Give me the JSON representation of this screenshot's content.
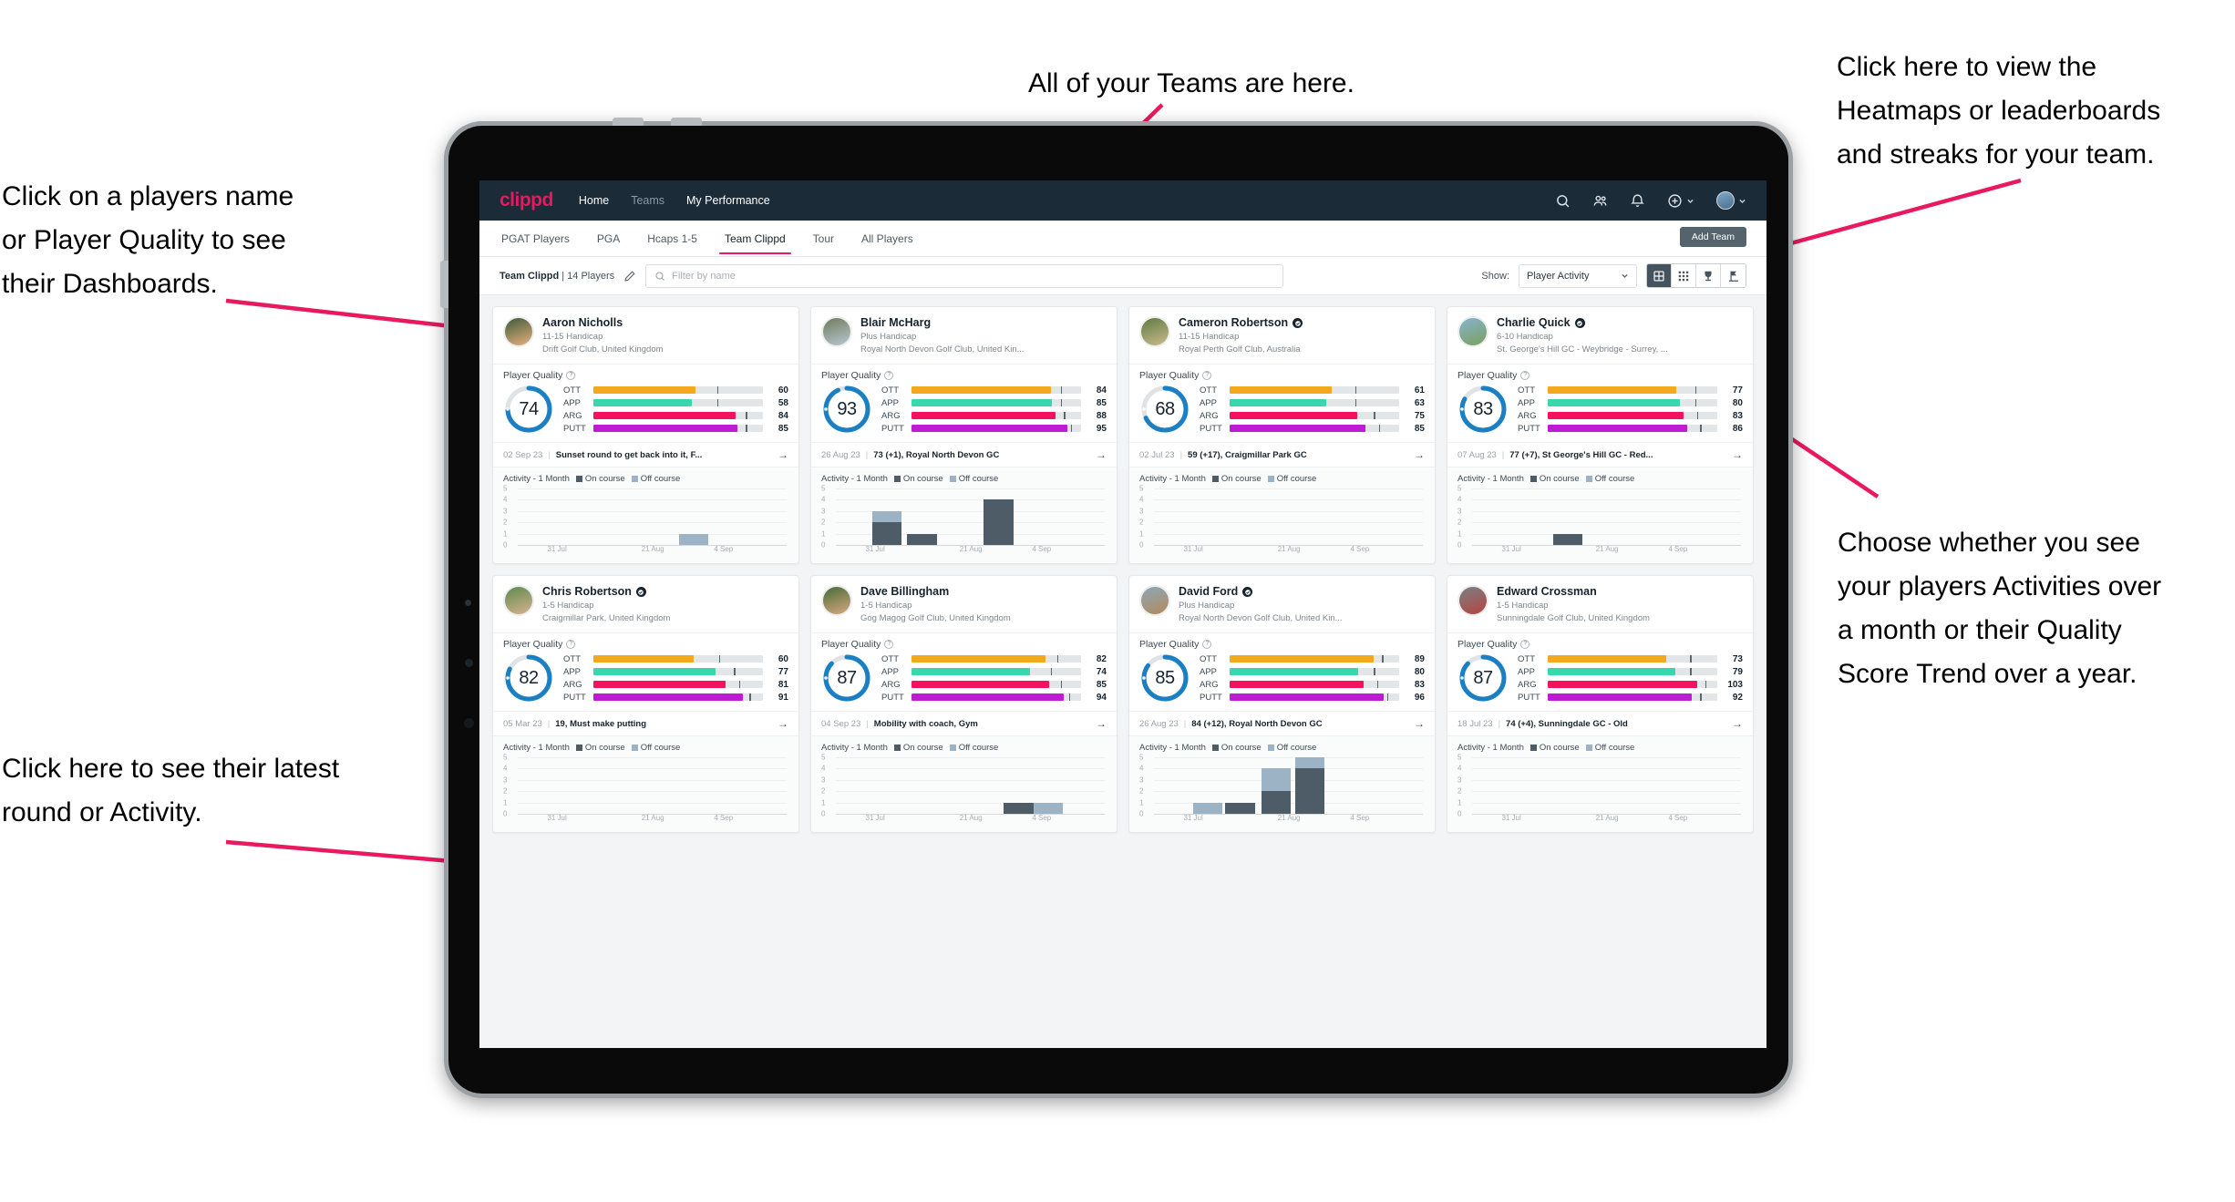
{
  "annotations": [
    {
      "id": "teams",
      "text": "All of your Teams are here."
    },
    {
      "id": "heatmaps",
      "text": "Click here to view the\nHeatmaps or leaderboards\nand streaks for your team."
    },
    {
      "id": "players-name",
      "text": "Click on a players name\nor Player Quality to see\ntheir Dashboards."
    },
    {
      "id": "activity-choice",
      "text": "Choose whether you see\nyour players Activities over\na month or their Quality\nScore Trend over a year."
    },
    {
      "id": "latest-round",
      "text": "Click here to see their latest\nround or Activity."
    }
  ],
  "topnav": {
    "brand": "clippd",
    "links": [
      {
        "label": "Home",
        "state": "active"
      },
      {
        "label": "Teams",
        "state": "dim"
      },
      {
        "label": "My Performance",
        "state": "active"
      }
    ],
    "icons": [
      "search-icon",
      "team-icon",
      "bell-icon",
      "plus-circle-icon",
      "avatar"
    ]
  },
  "subnav": {
    "tabs": [
      {
        "label": "PGAT Players",
        "active": false
      },
      {
        "label": "PGA",
        "active": false
      },
      {
        "label": "Hcaps 1-5",
        "active": false
      },
      {
        "label": "Team Clippd",
        "active": true
      },
      {
        "label": "Tour",
        "active": false
      },
      {
        "label": "All Players",
        "active": false
      }
    ],
    "add_team_label": "Add Team"
  },
  "filterbar": {
    "team_name": "Team Clippd",
    "team_count": "| 14 Players",
    "edit_icon": "pencil-icon",
    "search_placeholder": "Filter by name",
    "show_label": "Show:",
    "show_value": "Player Activity",
    "view_buttons": [
      "grid-view-icon",
      "dense-grid-icon",
      "trophy-icon",
      "leaderboard-icon"
    ],
    "active_view": 0
  },
  "labels": {
    "player_quality": "Player Quality",
    "activity": "Activity - 1 Month",
    "on_course": "On course",
    "off_course": "Off course"
  },
  "colors": {
    "accent": "#e8195f",
    "navbar": "#1b2b38",
    "ring": "#1b7fc4",
    "ott": "#f4a81d",
    "app": "#3ad6ad",
    "arg": "#f4115e",
    "putt": "#c01bd4",
    "on_course": "#4d5c67",
    "off_course": "#9cb3c6"
  },
  "chart_axis": {
    "y_ticks": [
      "5",
      "4",
      "3",
      "2",
      "1",
      "0"
    ],
    "y_max": 5,
    "x_ticks": [
      "31 Jul",
      "21 Aug",
      "4 Sep"
    ]
  },
  "players": [
    {
      "name": "Aaron Nicholls",
      "verified": false,
      "handicap": "11-15 Handicap",
      "club": "Drift Golf Club, United Kingdom",
      "quality": 74,
      "avatar_colors": [
        "#3d5a3a",
        "#e8b27d"
      ],
      "metrics": [
        {
          "label": "OTT",
          "value": 60,
          "pct": 60,
          "tick": 73,
          "color": "#f4a81d"
        },
        {
          "label": "APP",
          "value": 58,
          "pct": 58,
          "tick": 73,
          "color": "#3ad6ad"
        },
        {
          "label": "ARG",
          "value": 84,
          "pct": 84,
          "tick": 90,
          "color": "#f4115e"
        },
        {
          "label": "PUTT",
          "value": 85,
          "pct": 85,
          "tick": 90,
          "color": "#c01bd4"
        }
      ],
      "round_date": "02 Sep 23",
      "round_text": "Sunset round to get back into it, F...",
      "activity": [
        {
          "x": 0.6,
          "on": 0,
          "off": 1
        }
      ]
    },
    {
      "name": "Blair McHarg",
      "verified": false,
      "handicap": "Plus Handicap",
      "club": "Royal North Devon Golf Club, United Kin...",
      "quality": 93,
      "avatar_colors": [
        "#6e7c5a",
        "#b9c7d4"
      ],
      "metrics": [
        {
          "label": "OTT",
          "value": 84,
          "pct": 82,
          "tick": 88,
          "color": "#f4a81d"
        },
        {
          "label": "APP",
          "value": 85,
          "pct": 83,
          "tick": 88,
          "color": "#3ad6ad"
        },
        {
          "label": "ARG",
          "value": 88,
          "pct": 85,
          "tick": 90,
          "color": "#f4115e"
        },
        {
          "label": "PUTT",
          "value": 95,
          "pct": 92,
          "tick": 94,
          "color": "#c01bd4"
        }
      ],
      "round_date": "26 Aug 23",
      "round_text": "73 (+1), Royal North Devon GC",
      "activity": [
        {
          "x": 0.135,
          "on": 2,
          "off": 1
        },
        {
          "x": 0.265,
          "on": 1,
          "off": 0
        },
        {
          "x": 0.55,
          "on": 4,
          "off": 0
        }
      ]
    },
    {
      "name": "Cameron Robertson",
      "verified": true,
      "handicap": "11-15 Handicap",
      "club": "Royal Perth Golf Club, Australia",
      "quality": 68,
      "avatar_colors": [
        "#5f7a42",
        "#cbbb8d"
      ],
      "metrics": [
        {
          "label": "OTT",
          "value": 61,
          "pct": 60,
          "tick": 74,
          "color": "#f4a81d"
        },
        {
          "label": "APP",
          "value": 63,
          "pct": 57,
          "tick": 74,
          "color": "#3ad6ad"
        },
        {
          "label": "ARG",
          "value": 75,
          "pct": 75,
          "tick": 85,
          "color": "#f4115e"
        },
        {
          "label": "PUTT",
          "value": 85,
          "pct": 80,
          "tick": 88,
          "color": "#c01bd4"
        }
      ],
      "round_date": "02 Jul 23",
      "round_text": "59 (+17), Craigmillar Park GC",
      "activity": []
    },
    {
      "name": "Charlie Quick",
      "verified": true,
      "handicap": "6-10 Handicap",
      "club": "St. George's Hill GC - Weybridge - Surrey, ...",
      "quality": 83,
      "avatar_colors": [
        "#87b3cf",
        "#7aa05d"
      ],
      "metrics": [
        {
          "label": "OTT",
          "value": 77,
          "pct": 76,
          "tick": 87,
          "color": "#f4a81d"
        },
        {
          "label": "APP",
          "value": 80,
          "pct": 78,
          "tick": 87,
          "color": "#3ad6ad"
        },
        {
          "label": "ARG",
          "value": 83,
          "pct": 80,
          "tick": 88,
          "color": "#f4115e"
        },
        {
          "label": "PUTT",
          "value": 86,
          "pct": 82,
          "tick": 90,
          "color": "#c01bd4"
        }
      ],
      "round_date": "07 Aug 23",
      "round_text": "77 (+7), St George's Hill GC - Red...",
      "activity": [
        {
          "x": 0.3,
          "on": 1,
          "off": 0
        }
      ]
    },
    {
      "name": "Chris Robertson",
      "verified": true,
      "handicap": "1-5 Handicap",
      "club": "Craigmillar Park, United Kingdom",
      "quality": 82,
      "avatar_colors": [
        "#5d8a4e",
        "#d9b28f"
      ],
      "metrics": [
        {
          "label": "OTT",
          "value": 60,
          "pct": 59,
          "tick": 74,
          "color": "#f4a81d"
        },
        {
          "label": "APP",
          "value": 77,
          "pct": 72,
          "tick": 83,
          "color": "#3ad6ad"
        },
        {
          "label": "ARG",
          "value": 81,
          "pct": 78,
          "tick": 86,
          "color": "#f4115e"
        },
        {
          "label": "PUTT",
          "value": 91,
          "pct": 88,
          "tick": 92,
          "color": "#c01bd4"
        }
      ],
      "round_date": "05 Mar 23",
      "round_text": "19, Must make putting",
      "activity": []
    },
    {
      "name": "Dave Billingham",
      "verified": false,
      "handicap": "1-5 Handicap",
      "club": "Gog Magog Golf Club, United Kingdom",
      "quality": 87,
      "avatar_colors": [
        "#456b3a",
        "#d9a87f"
      ],
      "metrics": [
        {
          "label": "OTT",
          "value": 82,
          "pct": 79,
          "tick": 86,
          "color": "#f4a81d"
        },
        {
          "label": "APP",
          "value": 74,
          "pct": 70,
          "tick": 82,
          "color": "#3ad6ad"
        },
        {
          "label": "ARG",
          "value": 85,
          "pct": 81,
          "tick": 88,
          "color": "#f4115e"
        },
        {
          "label": "PUTT",
          "value": 94,
          "pct": 90,
          "tick": 93,
          "color": "#c01bd4"
        }
      ],
      "round_date": "04 Sep 23",
      "round_text": "Mobility with coach, Gym",
      "activity": [
        {
          "x": 0.625,
          "on": 1,
          "off": 0
        },
        {
          "x": 0.735,
          "on": 0,
          "off": 1
        }
      ]
    },
    {
      "name": "David Ford",
      "verified": true,
      "handicap": "Plus Handicap",
      "club": "Royal North Devon Golf Club, United Kin...",
      "quality": 85,
      "avatar_colors": [
        "#8fa7b8",
        "#b08a5c"
      ],
      "metrics": [
        {
          "label": "OTT",
          "value": 89,
          "pct": 85,
          "tick": 90,
          "color": "#f4a81d"
        },
        {
          "label": "APP",
          "value": 80,
          "pct": 76,
          "tick": 85,
          "color": "#3ad6ad"
        },
        {
          "label": "ARG",
          "value": 83,
          "pct": 79,
          "tick": 87,
          "color": "#f4115e"
        },
        {
          "label": "PUTT",
          "value": 96,
          "pct": 91,
          "tick": 93,
          "color": "#c01bd4"
        }
      ],
      "round_date": "26 Aug 23",
      "round_text": "84 (+12), Royal North Devon GC",
      "activity": [
        {
          "x": 0.145,
          "on": 0,
          "off": 1
        },
        {
          "x": 0.265,
          "on": 1,
          "off": 0
        },
        {
          "x": 0.4,
          "on": 2,
          "off": 2
        },
        {
          "x": 0.525,
          "on": 4,
          "off": 1
        }
      ]
    },
    {
      "name": "Edward Crossman",
      "verified": false,
      "handicap": "1-5 Handicap",
      "club": "Sunningdale Golf Club, United Kingdom",
      "quality": 87,
      "avatar_colors": [
        "#7a7f84",
        "#b6453f"
      ],
      "metrics": [
        {
          "label": "OTT",
          "value": 73,
          "pct": 70,
          "tick": 84,
          "color": "#f4a81d"
        },
        {
          "label": "APP",
          "value": 79,
          "pct": 75,
          "tick": 84,
          "color": "#3ad6ad"
        },
        {
          "label": "ARG",
          "value": 103,
          "pct": 88,
          "tick": 93,
          "color": "#f4115e"
        },
        {
          "label": "PUTT",
          "value": 92,
          "pct": 85,
          "tick": 90,
          "color": "#c01bd4"
        }
      ],
      "round_date": "18 Jul 23",
      "round_text": "74 (+4), Sunningdale GC - Old",
      "activity": []
    }
  ]
}
